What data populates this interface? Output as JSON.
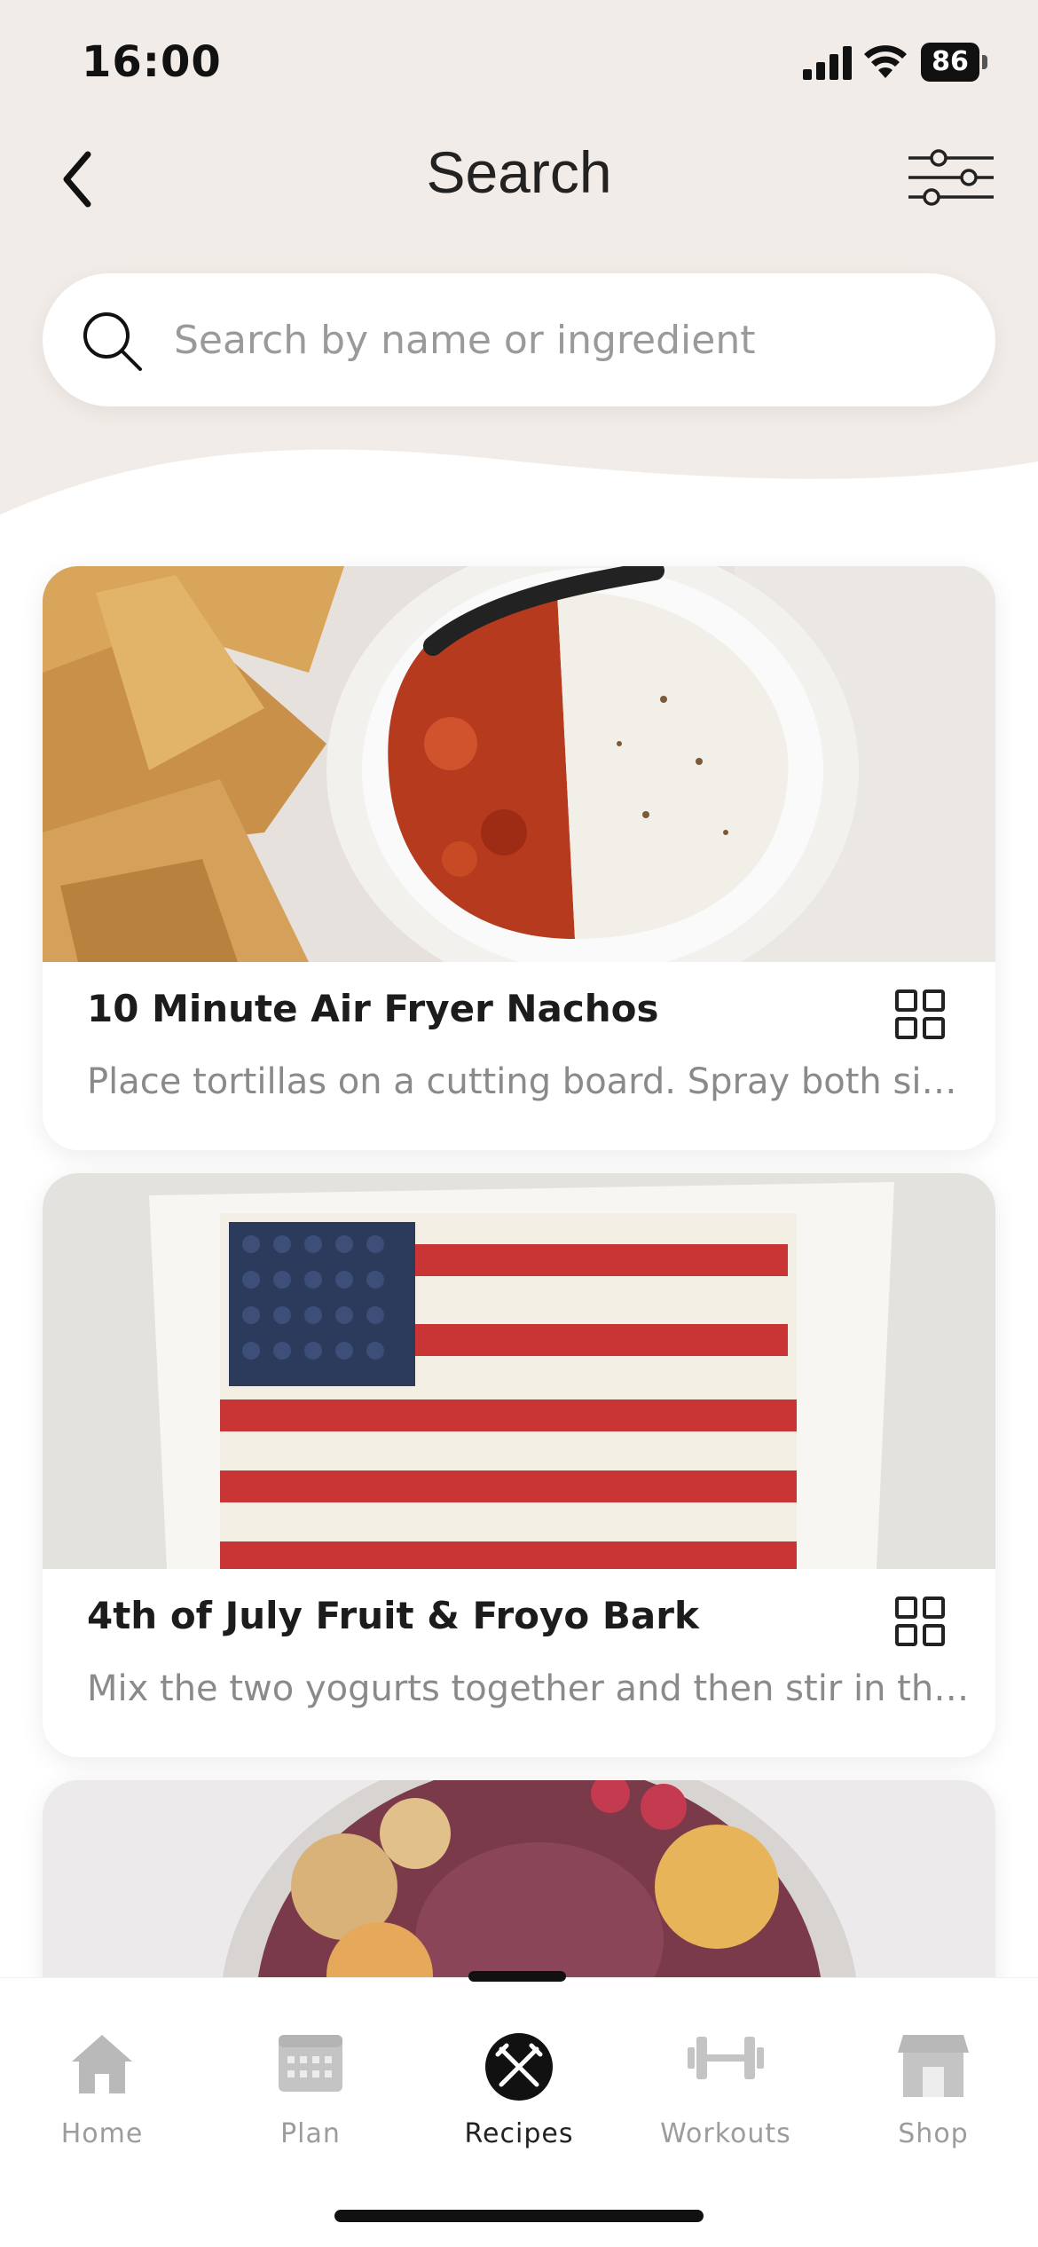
{
  "status_bar": {
    "time": "16:00",
    "battery": "86"
  },
  "header": {
    "title": "Search"
  },
  "search": {
    "placeholder": "Search by name or ingredient",
    "value": ""
  },
  "recipes": [
    {
      "title": "10 Minute Air Fryer Nachos",
      "description": "Place tortillas on a cutting board. Spray both sides with oil"
    },
    {
      "title": "4th of July Fruit & Froyo Bark",
      "description": "Mix the two yogurts together and then stir in the vanilla"
    }
  ],
  "tabbar": {
    "items": [
      {
        "label": "Home",
        "icon": "home-icon"
      },
      {
        "label": "Plan",
        "icon": "calendar-icon"
      },
      {
        "label": "Recipes",
        "icon": "recipes-icon",
        "active": true
      },
      {
        "label": "Workouts",
        "icon": "dumbbell-icon"
      },
      {
        "label": "Shop",
        "icon": "shop-icon"
      }
    ]
  },
  "colors": {
    "header_bg": "#f1ece7",
    "active_tab": "#111111",
    "inactive_tab": "#9c9c9c"
  }
}
